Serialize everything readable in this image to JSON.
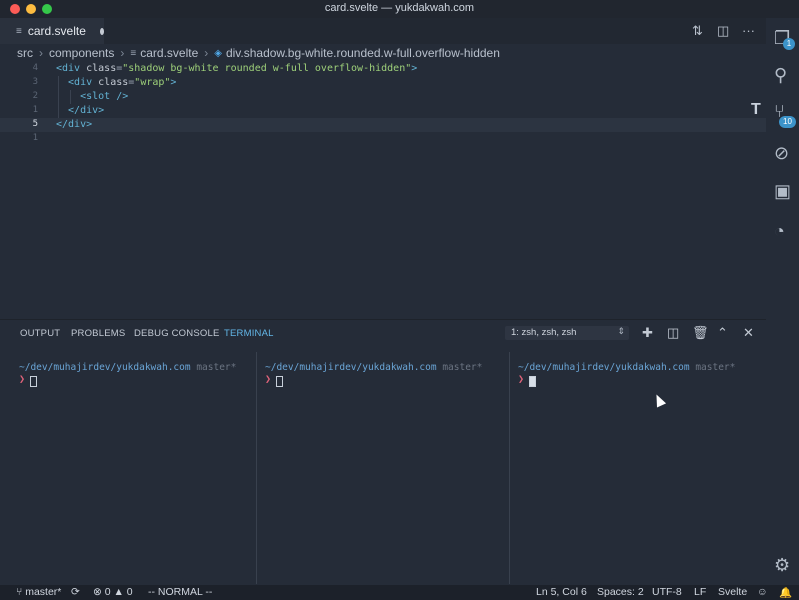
{
  "window": {
    "title": "card.svelte — yukdakwah.com"
  },
  "tab": {
    "label": "card.svelte",
    "file_icon": "file-lines-icon"
  },
  "breadcrumb": {
    "items": [
      "src",
      "components",
      "card.svelte",
      "div.shadow.bg-white.rounded.w-full.overflow-hidden"
    ]
  },
  "editor": {
    "lines": [
      {
        "num": "4",
        "tokens": [
          {
            "t": "<div ",
            "c": "tag"
          },
          {
            "t": "class",
            "c": "attr"
          },
          {
            "t": "=",
            "c": "punct"
          },
          {
            "t": "\"shadow bg-white rounded w-full overflow-hidden\"",
            "c": "str"
          },
          {
            "t": ">",
            "c": "tag"
          }
        ]
      },
      {
        "num": "3",
        "tokens": [
          {
            "t": "  <div ",
            "c": "tag"
          },
          {
            "t": "class",
            "c": "attr"
          },
          {
            "t": "=",
            "c": "punct"
          },
          {
            "t": "\"wrap\"",
            "c": "str"
          },
          {
            "t": ">",
            "c": "tag"
          }
        ]
      },
      {
        "num": "2",
        "tokens": [
          {
            "t": "    <slot />",
            "c": "tag"
          }
        ]
      },
      {
        "num": "1",
        "tokens": [
          {
            "t": "  </div>",
            "c": "tag"
          }
        ]
      },
      {
        "num": "5",
        "tokens": [
          {
            "t": "</div>",
            "c": "tag"
          }
        ]
      },
      {
        "num": "1",
        "tokens": []
      }
    ],
    "current_line": 4
  },
  "panel": {
    "tabs": [
      "OUTPUT",
      "PROBLEMS",
      "DEBUG CONSOLE",
      "TERMINAL"
    ],
    "active_tab": "TERMINAL",
    "terminal_select": "1: zsh, zsh, zsh"
  },
  "terminal": {
    "panes": [
      {
        "path": "~/dev/muhajirdev/yukdakwah.com",
        "branch": "master*",
        "arrow": "❯"
      },
      {
        "path": "~/dev/muhajirdev/yukdakwah.com",
        "branch": "master*",
        "arrow": "❯"
      },
      {
        "path": "~/dev/muhajirdev/yukdakwah.com",
        "branch": "master*",
        "arrow": "❯"
      }
    ]
  },
  "activity": {
    "badges": {
      "explorer": "1",
      "scm": "10"
    }
  },
  "statusbar": {
    "branch": "master*",
    "errors": "0",
    "warnings": "0",
    "mode": "-- NORMAL --",
    "position": "Ln 5, Col 6",
    "spaces": "Spaces: 2",
    "encoding": "UTF-8",
    "eol": "LF",
    "language": "Svelte"
  },
  "colors": {
    "accent": "#62b6e7",
    "background": "#252c38",
    "statusbar": "#1c212a"
  }
}
